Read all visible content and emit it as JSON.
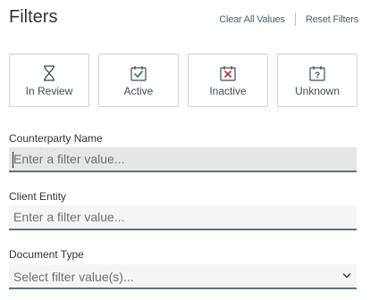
{
  "header": {
    "title": "Filters",
    "clear_all_label": "Clear All Values",
    "reset_label": "Reset Filters"
  },
  "statuses": [
    {
      "label": "In Review",
      "icon": "hourglass-icon",
      "color": "#3c4e5d"
    },
    {
      "label": "Active",
      "icon": "calendar-check-icon",
      "color": "#2e8b57"
    },
    {
      "label": "Inactive",
      "icon": "calendar-x-icon",
      "color": "#c0392b"
    },
    {
      "label": "Unknown",
      "icon": "calendar-question-icon",
      "color": "#3c4e5d"
    }
  ],
  "fields": {
    "counterparty": {
      "label": "Counterparty Name",
      "placeholder": "Enter a filter value...",
      "value": ""
    },
    "client_entity": {
      "label": "Client Entity",
      "placeholder": "Enter a filter value...",
      "value": ""
    },
    "document_type": {
      "label": "Document Type",
      "placeholder": "Select filter value(s)..."
    }
  },
  "colors": {
    "accent": "#5c7287",
    "link": "#4a6378",
    "input_bg": "#f5f5f5",
    "input_bg_focused": "#e6e6e6"
  }
}
